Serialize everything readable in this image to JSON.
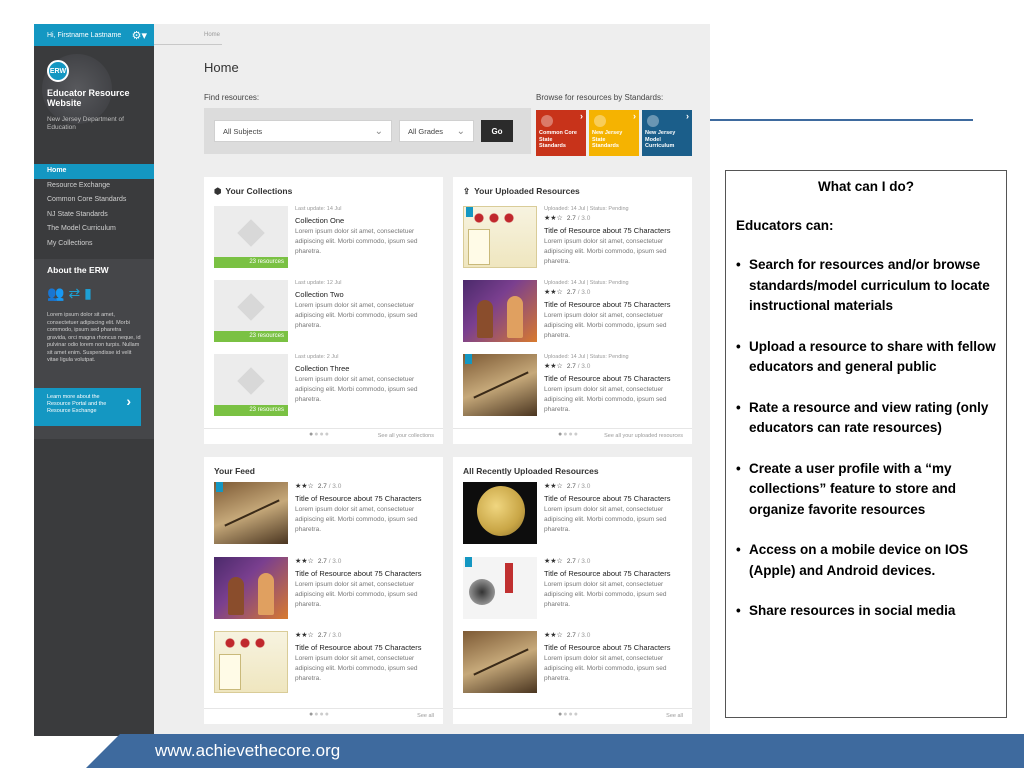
{
  "sidebar": {
    "greeting": "Hi, Firstname Lastname",
    "logo_badge": "ERW",
    "site_name": "Educator Resource Website",
    "department": "New Jersey Department of Education",
    "nav": [
      {
        "label": "Home",
        "active": true
      },
      {
        "label": "Resource Exchange"
      },
      {
        "label": "Common Core Standards"
      },
      {
        "label": "NJ State Standards"
      },
      {
        "label": "The Model Curriculum"
      },
      {
        "label": "My Collections"
      }
    ],
    "about_title": "About the ERW",
    "about_text": "Lorem ipsum dolor sit amet, consectetuer adipiscing elit. Morbi commodo, ipsum sed pharetra gravida, orci magna rhoncus neque, id pulvinar odio lorem non turpis. Nullam sit amet enim. Suspendisse id velit vitae ligula volutpat.",
    "learn_more": "Learn more about the Resource Portal and the Resource Exchange"
  },
  "main": {
    "breadcrumb": "Home",
    "title": "Home",
    "find_label": "Find resources:",
    "subject_select": "All Subjects",
    "grade_select": "All Grades",
    "go_label": "Go",
    "standards_label": "Browse for resources by Standards:",
    "standards": [
      {
        "label": "Common Core State Standards",
        "color": "#c8331a"
      },
      {
        "label": "New Jersey State Standards",
        "color": "#f5b301"
      },
      {
        "label": "New Jersey Model Curriculum",
        "color": "#1b5e8a"
      }
    ]
  },
  "collections": {
    "title": "Your Collections",
    "items": [
      {
        "meta": "Last update: 14 Jul",
        "title": "Collection One",
        "desc": "Lorem ipsum dolor sit amet, consectetuer adipiscing elit. Morbi commodo, ipsum sed pharetra.",
        "count": "23 resources"
      },
      {
        "meta": "Last update: 12 Jul",
        "title": "Collection Two",
        "desc": "Lorem ipsum dolor sit amet, consectetuer adipiscing elit. Morbi commodo, ipsum sed pharetra.",
        "count": "23 resources"
      },
      {
        "meta": "Last update: 2 Jul",
        "title": "Collection Three",
        "desc": "Lorem ipsum dolor sit amet, consectetuer adipiscing elit. Morbi commodo, ipsum sed pharetra.",
        "count": "23 resources"
      }
    ],
    "see_all": "See all your collections"
  },
  "uploaded": {
    "title": "Your Uploaded Resources",
    "items": [
      {
        "meta": "Uploaded: 14 Jul  |  Status: Pending",
        "stars": "★★☆",
        "score": "2.7",
        "max": "/ 3.0",
        "title": "Title of Resource about 75 Characters",
        "desc": "Lorem ipsum dolor sit amet, consectetuer adipiscing elit. Morbi commodo, ipsum sed pharetra."
      },
      {
        "meta": "Uploaded: 14 Jul  |  Status: Pending",
        "stars": "★★☆",
        "score": "2.7",
        "max": "/ 3.0",
        "title": "Title of Resource about 75 Characters",
        "desc": "Lorem ipsum dolor sit amet, consectetuer adipiscing elit. Morbi commodo, ipsum sed pharetra."
      },
      {
        "meta": "Uploaded: 14 Jul  |  Status: Pending",
        "stars": "★★☆",
        "score": "2.7",
        "max": "/ 3.0",
        "title": "Title of Resource about 75 Characters",
        "desc": "Lorem ipsum dolor sit amet, consectetuer adipiscing elit. Morbi commodo, ipsum sed pharetra."
      }
    ],
    "see_all": "See all your uploaded resources"
  },
  "feed": {
    "title": "Your Feed",
    "items": [
      {
        "stars": "★★☆",
        "score": "2.7",
        "max": "/ 3.0",
        "title": "Title of Resource about 75 Characters",
        "desc": "Lorem ipsum dolor sit amet, consectetuer adipiscing elit. Morbi commodo, ipsum sed pharetra."
      },
      {
        "stars": "★★☆",
        "score": "2.7",
        "max": "/ 3.0",
        "title": "Title of Resource about 75 Characters",
        "desc": "Lorem ipsum dolor sit amet, consectetuer adipiscing elit. Morbi commodo, ipsum sed pharetra."
      },
      {
        "stars": "★★☆",
        "score": "2.7",
        "max": "/ 3.0",
        "title": "Title of Resource about 75 Characters",
        "desc": "Lorem ipsum dolor sit amet, consectetuer adipiscing elit. Morbi commodo, ipsum sed pharetra."
      }
    ],
    "see_all": "See all"
  },
  "recent": {
    "title": "All Recently Uploaded Resources",
    "items": [
      {
        "stars": "★★☆",
        "score": "2.7",
        "max": "/ 3.0",
        "title": "Title of Resource about 75 Characters",
        "desc": "Lorem ipsum dolor sit amet, consectetuer adipiscing elit. Morbi commodo, ipsum sed pharetra."
      },
      {
        "stars": "★★☆",
        "score": "2.7",
        "max": "/ 3.0",
        "title": "Title of Resource about 75 Characters",
        "desc": "Lorem ipsum dolor sit amet, consectetuer adipiscing elit. Morbi commodo, ipsum sed pharetra."
      },
      {
        "stars": "★★☆",
        "score": "2.7",
        "max": "/ 3.0",
        "title": "Title of Resource about 75 Characters",
        "desc": "Lorem ipsum dolor sit amet, consectetuer adipiscing elit. Morbi commodo, ipsum sed pharetra."
      }
    ],
    "see_all": "See all"
  },
  "info": {
    "heading": "What can I do?",
    "lead": "Educators can:",
    "bullets": [
      "Search for resources and/or browse standards/model curriculum to locate instructional materials",
      "Upload a resource to share with fellow educators and general public",
      "Rate a resource and view rating (only educators can rate resources)",
      "Create a user profile with a “my collections” feature to store  and organize favorite resources",
      "Access  on a mobile device on IOS (Apple) and Android devices.",
      "Share resources in social media"
    ]
  },
  "footer": {
    "url": "www.achievethecore.org",
    "band_color": "#3e6a9e"
  }
}
